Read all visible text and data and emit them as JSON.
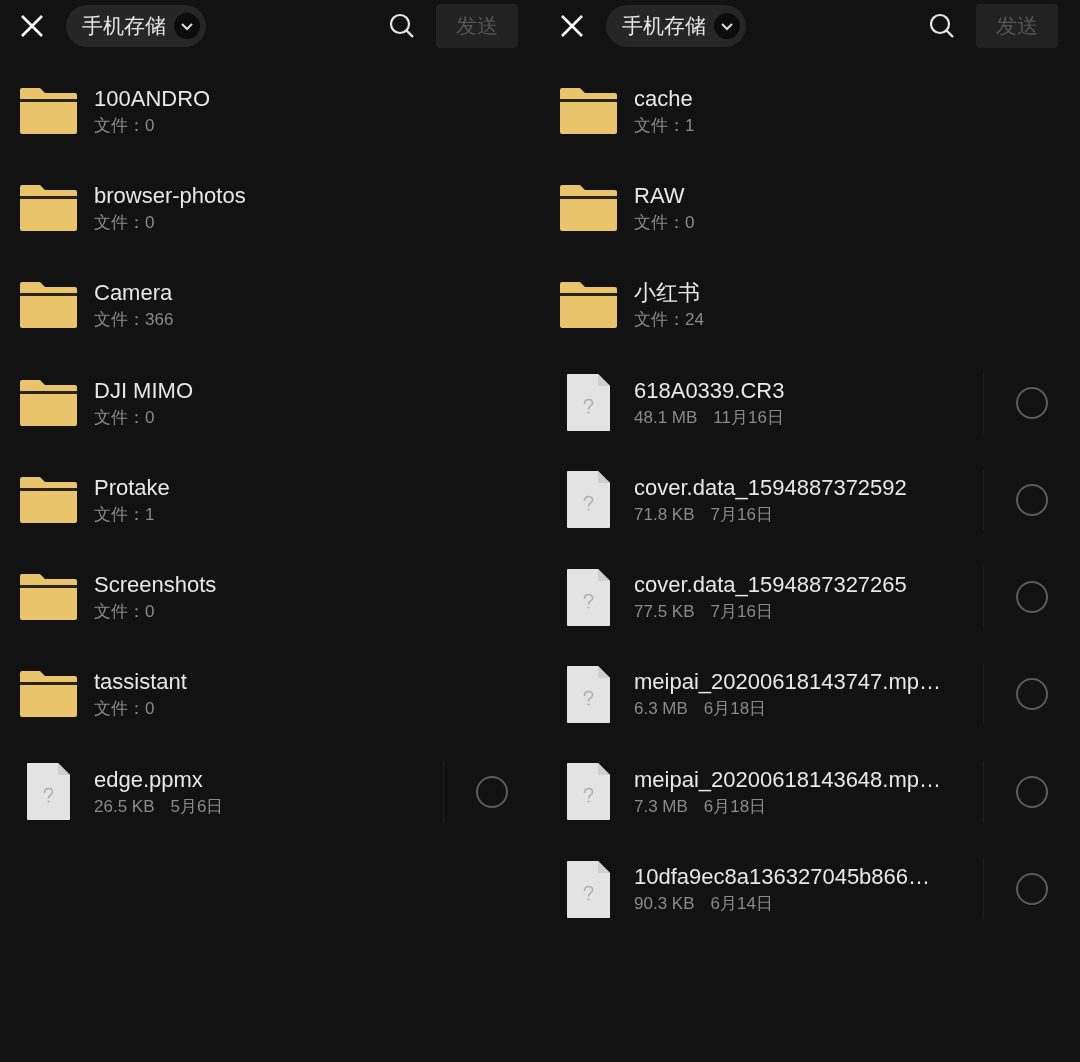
{
  "panels": [
    {
      "location": "手机存储",
      "send_button": {
        "label": "发送",
        "disabled": true
      },
      "items": [
        {
          "kind": "folder",
          "name": "100ANDRO",
          "count": "文件：0"
        },
        {
          "kind": "folder",
          "name": "browser-photos",
          "count": "文件：0"
        },
        {
          "kind": "folder",
          "name": "Camera",
          "count": "文件：366"
        },
        {
          "kind": "folder",
          "name": "DJI MIMO",
          "count": "文件：0"
        },
        {
          "kind": "folder",
          "name": "Protake",
          "count": "文件：1"
        },
        {
          "kind": "folder",
          "name": "Screenshots",
          "count": "文件：0"
        },
        {
          "kind": "folder",
          "name": "tassistant",
          "count": "文件：0"
        },
        {
          "kind": "file",
          "name": "edge.ppmx",
          "size": "26.5 KB",
          "date": "5月6日",
          "selected": false
        }
      ]
    },
    {
      "location": "手机存储",
      "send_button": {
        "label": "发送",
        "disabled": true
      },
      "items": [
        {
          "kind": "folder",
          "name": "cache",
          "count": "文件：1"
        },
        {
          "kind": "folder",
          "name": "RAW",
          "count": "文件：0"
        },
        {
          "kind": "folder",
          "name": "小红书",
          "count": "文件：24"
        },
        {
          "kind": "file",
          "name": "618A0339.CR3",
          "size": "48.1 MB",
          "date": "11月16日",
          "selected": false
        },
        {
          "kind": "file",
          "name": "cover.data_1594887372592",
          "size": "71.8 KB",
          "date": "7月16日",
          "selected": false
        },
        {
          "kind": "file",
          "name": "cover.data_1594887327265",
          "size": "77.5 KB",
          "date": "7月16日",
          "selected": false
        },
        {
          "kind": "file",
          "name": "meipai_20200618143747.mp…",
          "size": "6.3 MB",
          "date": "6月18日",
          "selected": false
        },
        {
          "kind": "file",
          "name": "meipai_20200618143648.mp…",
          "size": "7.3 MB",
          "date": "6月18日",
          "selected": false
        },
        {
          "kind": "file",
          "name": "10dfa9ec8a136327045b866…",
          "size": "90.3 KB",
          "date": "6月14日",
          "selected": false
        }
      ]
    }
  ]
}
